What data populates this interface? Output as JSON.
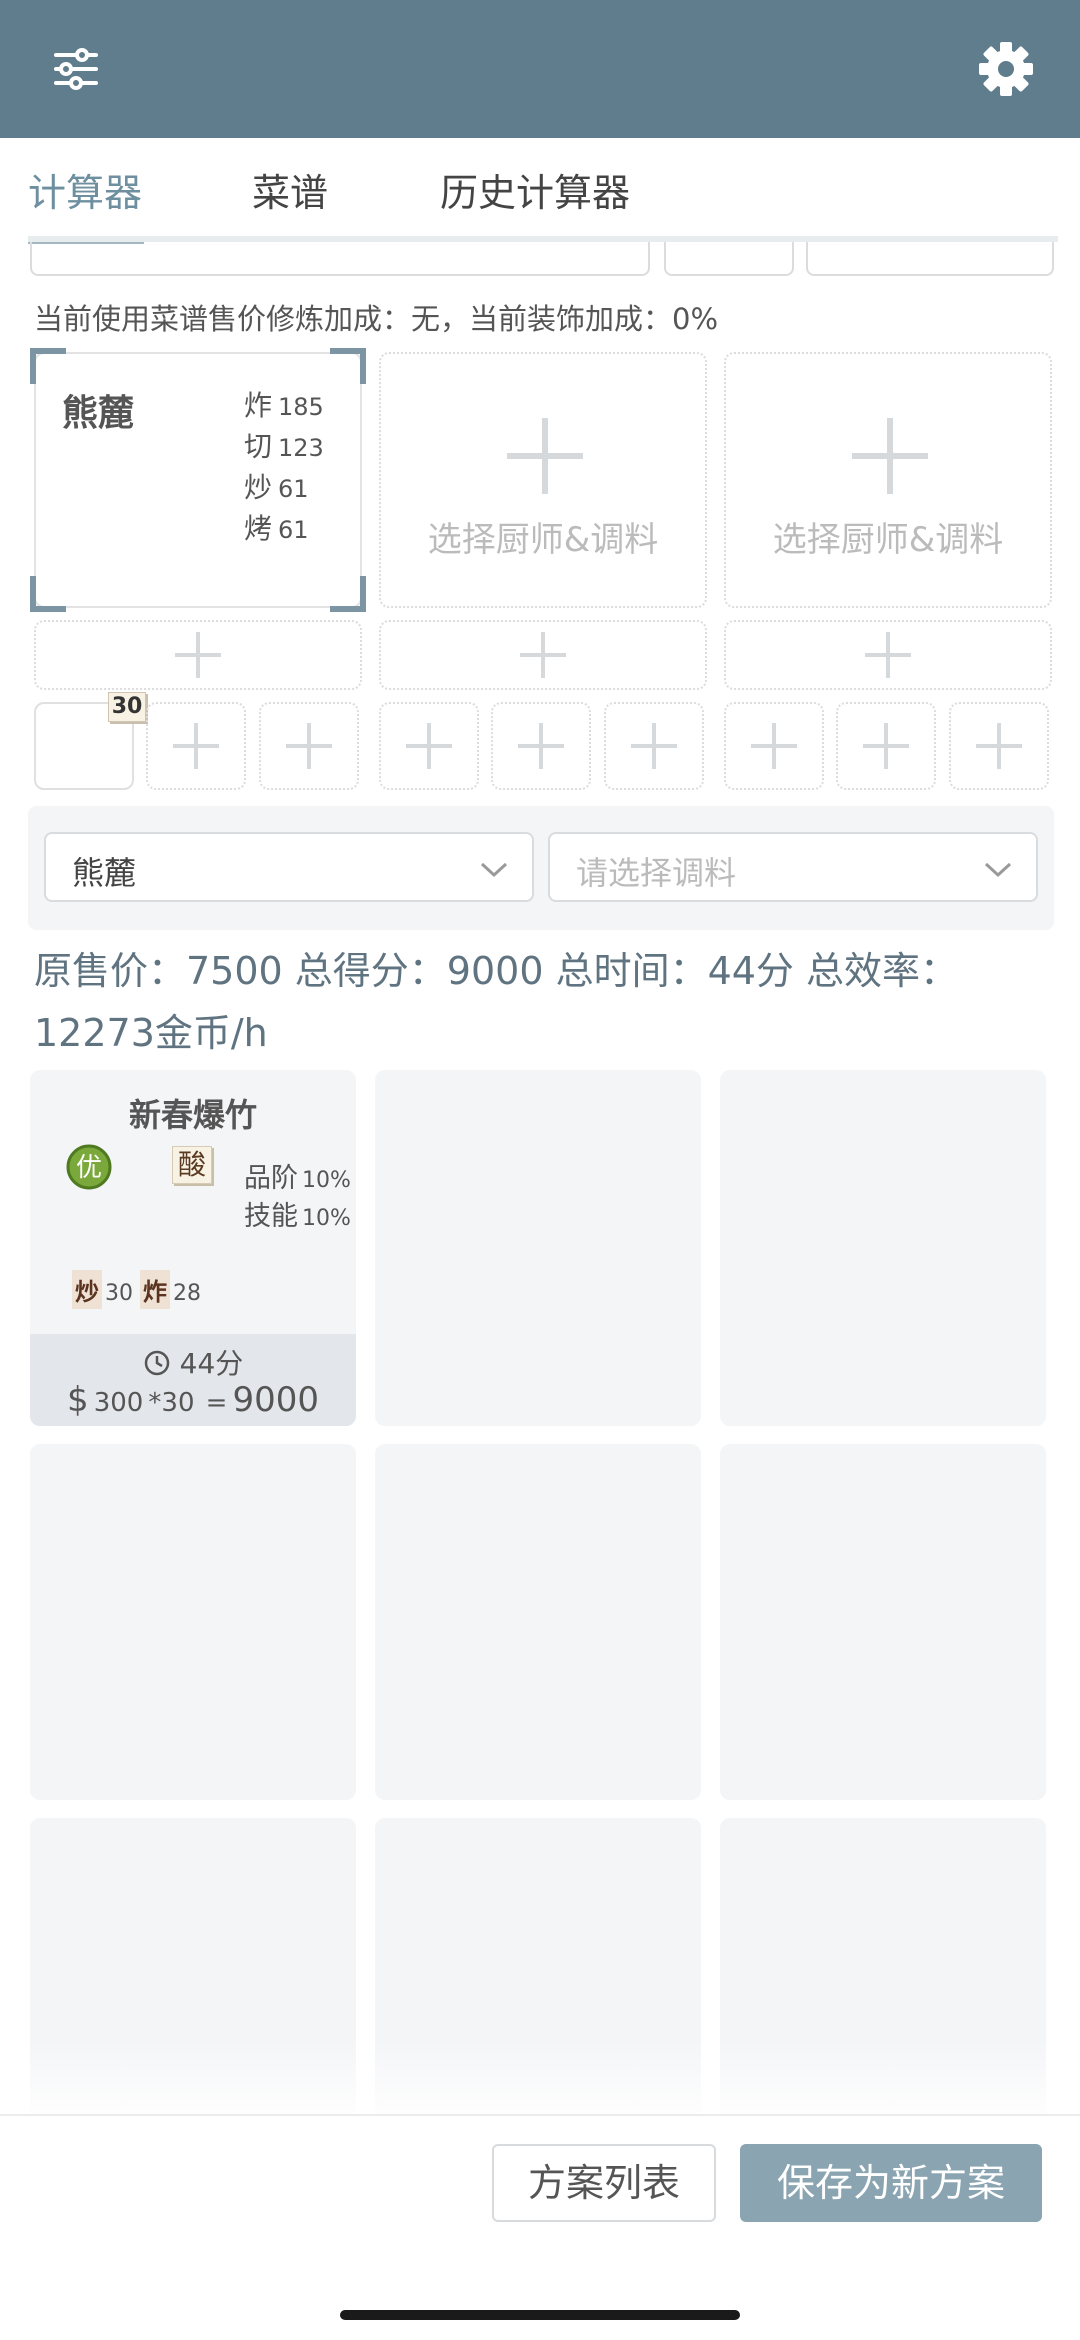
{
  "header": {
    "left_icon": "sliders-icon",
    "right_icon": "gear-icon",
    "background_color": "#5f7d8c"
  },
  "tabs": [
    {
      "label": "计算器",
      "active": true
    },
    {
      "label": "菜谱",
      "active": false
    },
    {
      "label": "历史计算器",
      "active": false
    }
  ],
  "notice": "当前使用菜谱售价修炼加成：无，当前装饰加成：0%",
  "chefs": [
    {
      "name": "熊麓",
      "skills": [
        {
          "label": "炸",
          "value": "185"
        },
        {
          "label": "切",
          "value": "123"
        },
        {
          "label": "炒",
          "value": "61"
        },
        {
          "label": "烤",
          "value": "61"
        }
      ]
    },
    {
      "placeholder": "选择厨师&调料"
    },
    {
      "placeholder": "选择厨师&调料"
    }
  ],
  "slot_badge": "30",
  "selectors": {
    "chef_value": "熊麓",
    "seasoning_placeholder": "请选择调料"
  },
  "summary": "原售价：7500 总得分：9000 总时间：44分 总效率：12273金币/h",
  "recipe": {
    "name": "新春爆竹",
    "rank_icon": "优",
    "flavor": "酸",
    "bonus_quality_label": "品阶",
    "bonus_quality_value": "10%",
    "bonus_skill_label": "技能",
    "bonus_skill_value": "10%",
    "req1_label": "炒",
    "req1_value": "30",
    "req2_label": "炸",
    "req2_value": "28",
    "time": "44分",
    "price_symbol": "$",
    "price_unit": "300",
    "price_qty": "*30",
    "price_eq": "=",
    "price_total": "9000"
  },
  "buttons": {
    "plan_list": "方案列表",
    "save_new": "保存为新方案"
  },
  "colors": {
    "accent": "#6e8fa0",
    "primary_button": "#8aa4b1",
    "rank_green": "#7aa83a"
  }
}
